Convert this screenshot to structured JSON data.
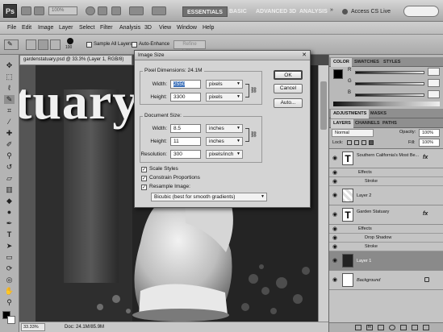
{
  "app": {
    "logo": "Ps",
    "zoom_level": "100%",
    "workspaces": [
      "ESSENTIALS",
      "BASIC",
      "ADVANCED 3D",
      "ANALYSIS"
    ],
    "more_workspaces": "»",
    "cs_live": "Access CS Live"
  },
  "menu": [
    "File",
    "Edit",
    "Image",
    "Layer",
    "Select",
    "Filter",
    "Analysis",
    "3D",
    "View",
    "Window",
    "Help"
  ],
  "options_bar": {
    "brush_size": "100",
    "sample_all_layers": "Sample All Layers",
    "auto_enhance": "Auto-Enhance",
    "refine_edge": "Refine Edge..."
  },
  "document": {
    "tab_title": "gardenstatuary.psd @ 33.3% (Layer 1, RGB/8)",
    "canvas_text": "tuary",
    "status_zoom": "33.33%",
    "status_doc": "Doc: 24.1M/85.9M"
  },
  "dialog": {
    "title": "Image Size",
    "pixel_dimensions": "Pixel Dimensions: 24.1M",
    "width_label": "Width:",
    "width_value": "2550",
    "width_unit": "pixels",
    "height_label": "Height:",
    "height_value": "3300",
    "height_unit": "pixels",
    "document_size": "Document Size:",
    "doc_width_value": "8.5",
    "doc_width_unit": "inches",
    "doc_height_value": "11",
    "doc_height_unit": "inches",
    "resolution_label": "Resolution:",
    "resolution_value": "300",
    "resolution_unit": "pixels/inch",
    "scale_styles": "Scale Styles",
    "constrain_proportions": "Constrain Proportions",
    "resample_image": "Resample Image:",
    "resample_method": "Bicubic (best for smooth gradients)",
    "ok": "OK",
    "cancel": "Cancel",
    "auto": "Auto..."
  },
  "color_panel": {
    "tabs": [
      "COLOR",
      "SWATCHES",
      "STYLES"
    ],
    "channels": [
      "R",
      "G",
      "B"
    ]
  },
  "adjustments_panel": {
    "tabs": [
      "ADJUSTMENTS",
      "MASKS"
    ]
  },
  "layers_panel": {
    "tabs": [
      "LAYERS",
      "CHANNELS",
      "PATHS"
    ],
    "blend_mode": "Normal",
    "opacity_label": "Opacity:",
    "opacity_value": "100%",
    "lock_label": "Lock:",
    "fill_label": "Fill:",
    "fill_value": "100%",
    "layers": [
      {
        "name": "Southern California's Most Be...",
        "thumb": "T",
        "fx": "fx"
      },
      {
        "name": "Effects",
        "sub": true
      },
      {
        "name": "Stroke",
        "sub": true
      },
      {
        "name": "Layer 2",
        "thumb": ""
      },
      {
        "name": "Garden Statuary",
        "thumb": "T",
        "fx": "fx"
      },
      {
        "name": "Effects",
        "sub": true
      },
      {
        "name": "Drop Shadow",
        "sub": true
      },
      {
        "name": "Stroke",
        "sub": true
      },
      {
        "name": "Layer 1",
        "thumb": ""
      },
      {
        "name": "Background",
        "thumb": ""
      }
    ]
  }
}
